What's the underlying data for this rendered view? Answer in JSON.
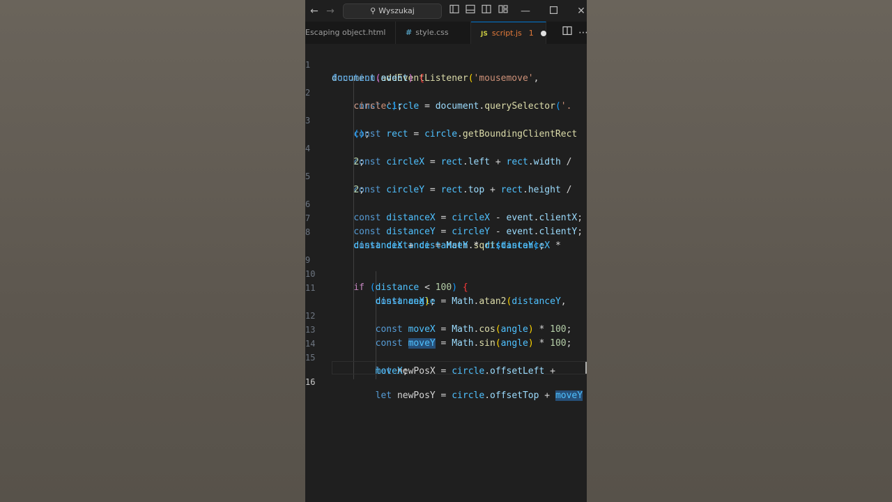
{
  "titlebar": {
    "search_placeholder": "Wyszukaj"
  },
  "tabs": [
    {
      "label": "Escaping object.html",
      "active": false
    },
    {
      "label": "style.css",
      "icon": "#",
      "active": false
    },
    {
      "label": "script.js",
      "icon": "JS",
      "active": true,
      "problems": "1",
      "unsaved": true
    }
  ],
  "editor": {
    "language": "javascript",
    "current_line": 16,
    "line_numbers": [
      "1",
      "2",
      "3",
      "4",
      "5",
      "6",
      "7",
      "8",
      "9",
      "10",
      "11",
      "12",
      "13",
      "14",
      "15",
      "16"
    ],
    "lines": [
      "document.addEventListener('mousemove',",
      "function(event) {",
      "    const circle = document.querySelector('.",
      "    circle');",
      "    const rect = circle.getBoundingClientRect",
      "    ();",
      "    const circleX = rect.left + rect.width /",
      "    2;",
      "    const circleY = rect.top + rect.height /",
      "    2;",
      "    const distanceX = circleX - event.clientX;",
      "    const distanceY = circleY - event.clientY;",
      "    const distance = Math.sqrt(distanceX *",
      "    distanceX + distanceY * distanceY);",
      "",
      "    if (distance < 100) {",
      "        const angle = Math.atan2(distanceY,",
      "        distanceX);",
      "        const moveX = Math.cos(angle) * 100;",
      "        const moveY = Math.sin(angle) * 100;",
      "",
      "        let newPosX = circle.offsetLeft +",
      "        moveX;",
      "        let newPosY = circle.offsetTop + moveY"
    ]
  }
}
